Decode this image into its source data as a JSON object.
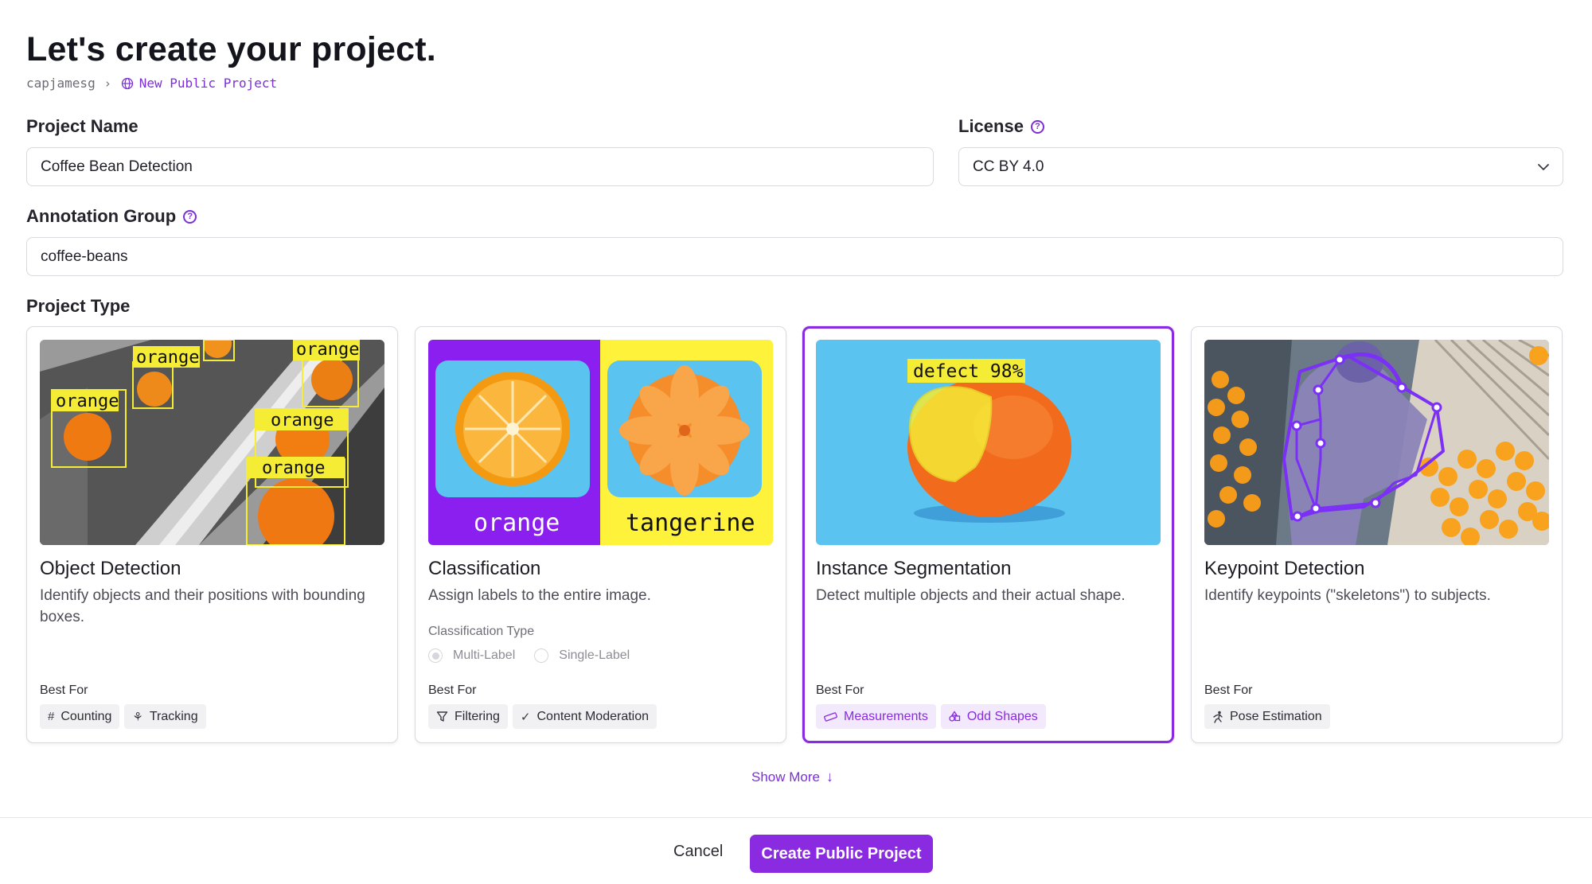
{
  "page": {
    "title": "Let's create your project.",
    "breadcrumb_user": "capjamesg",
    "breadcrumb_sep": "›",
    "breadcrumb_project": "New Public Project"
  },
  "form": {
    "project_name_label": "Project Name",
    "project_name_value": "Coffee Bean Detection",
    "license_label": "License",
    "license_value": "CC BY 4.0",
    "annotation_group_label": "Annotation Group",
    "annotation_group_value": "coffee-beans",
    "project_type_label": "Project Type"
  },
  "cards": [
    {
      "title": "Object Detection",
      "description": "Identify objects and their positions with bounding boxes.",
      "best_for": "Best For",
      "tags": [
        {
          "icon": "hash-icon",
          "glyph": "#",
          "label": "Counting"
        },
        {
          "icon": "tracking-icon",
          "glyph": "⚘",
          "label": "Tracking"
        }
      ],
      "image_labels": [
        "orange",
        "orange",
        "orange",
        "orange",
        "orange"
      ],
      "selected": false
    },
    {
      "title": "Classification",
      "description": "Assign labels to the entire image.",
      "classification_type_label": "Classification Type",
      "options": [
        "Multi-Label",
        "Single-Label"
      ],
      "selected_option": "Multi-Label",
      "best_for": "Best For",
      "tags": [
        {
          "icon": "filter-icon",
          "glyph": "⛉",
          "label": "Filtering"
        },
        {
          "icon": "check-icon",
          "glyph": "✓",
          "label": "Content Moderation"
        }
      ],
      "image_labels": [
        "orange",
        "tangerine"
      ],
      "selected": false
    },
    {
      "title": "Instance Segmentation",
      "description": "Detect multiple objects and their actual shape.",
      "best_for": "Best For",
      "tags": [
        {
          "icon": "ruler-icon",
          "glyph": "⏥",
          "label": "Measurements"
        },
        {
          "icon": "shapes-icon",
          "glyph": "⬠",
          "label": "Odd Shapes"
        }
      ],
      "image_labels": [
        "defect 98%"
      ],
      "selected": true
    },
    {
      "title": "Keypoint Detection",
      "description": "Identify keypoints (\"skeletons\") to subjects.",
      "best_for": "Best For",
      "tags": [
        {
          "icon": "person-running-icon",
          "glyph": "🏃",
          "label": "Pose Estimation"
        }
      ],
      "selected": false
    }
  ],
  "show_more": "Show More",
  "footer": {
    "cancel": "Cancel",
    "create": "Create Public Project"
  },
  "colors": {
    "accent": "#8a2be2",
    "detection_box": "#f5ec36",
    "classification_purple": "#8a1ff0",
    "classification_yellow": "#fff23a",
    "segmentation_bg": "#5ac3ef",
    "keypoint_purple": "#7b2ff7"
  }
}
